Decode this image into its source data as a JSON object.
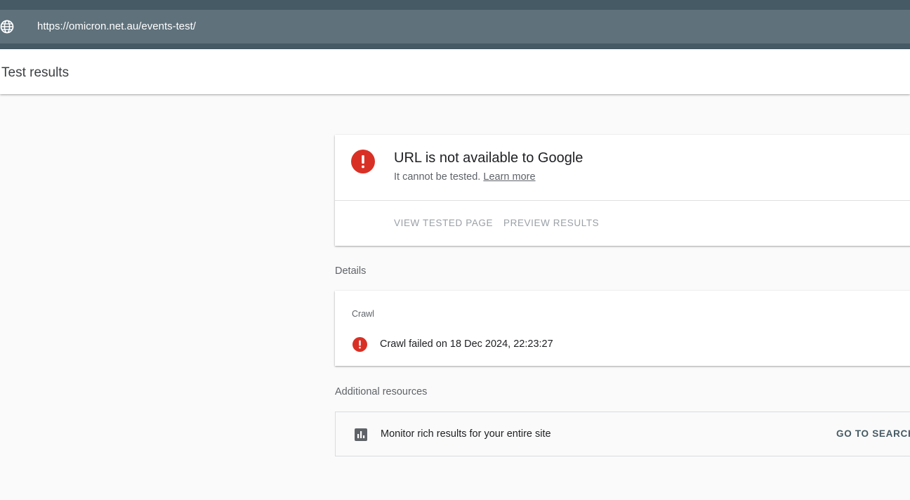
{
  "address_bar": {
    "url": "https://omicron.net.au/events-test/",
    "icon": "globe-icon"
  },
  "header": {
    "title": "Test results"
  },
  "summary": {
    "icon": "error-icon",
    "title": "URL is not available to Google",
    "subtitle": "It cannot be tested.",
    "learn_more": "Learn more",
    "actions": {
      "view_tested_page": "VIEW TESTED PAGE",
      "preview_results": "PREVIEW RESULTS"
    }
  },
  "details": {
    "label": "Details",
    "crawl": {
      "heading": "Crawl",
      "icon": "error-icon",
      "status": "Crawl failed on 18 Dec 2024, 22:23:27"
    }
  },
  "additional_resources": {
    "label": "Additional resources",
    "items": [
      {
        "icon": "bar-chart-icon",
        "text": "Monitor rich results for your entire site",
        "action": "GO TO SEARCH"
      }
    ]
  },
  "colors": {
    "top_bar": "#455a64",
    "url_bar": "#5f717b",
    "error_red": "#d93025",
    "background": "#fafafa"
  }
}
